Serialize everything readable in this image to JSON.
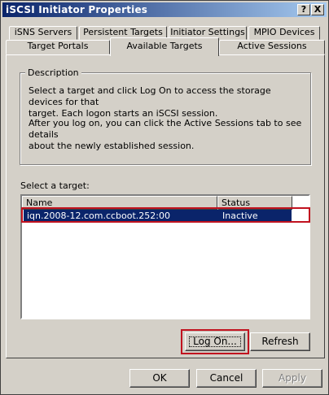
{
  "window": {
    "title": "iSCSI Initiator Properties"
  },
  "titlebar_buttons": {
    "help": "?",
    "close": "X"
  },
  "tabs_top": [
    "iSNS Servers",
    "Persistent Targets",
    "Initiator Settings",
    "MPIO Devices"
  ],
  "tabs_bottom": [
    "Target Portals",
    "Available Targets",
    "Active Sessions"
  ],
  "active_tab": "Available Targets",
  "description": {
    "label": "Description",
    "para1_line1": "Select a target and click Log On to access the storage devices for that",
    "para1_line2": "target. Each logon starts an iSCSI session.",
    "para2_line1": "After you log on, you can click the Active Sessions tab to see details",
    "para2_line2": "about the newly established session."
  },
  "targets": {
    "label": "Select a target:",
    "columns": [
      "Name",
      "Status"
    ],
    "rows": [
      {
        "name": "iqn.2008-12.com.ccboot.252:00",
        "status": "Inactive"
      }
    ]
  },
  "buttons": {
    "log_on": "Log On...",
    "refresh": "Refresh",
    "ok": "OK",
    "cancel": "Cancel",
    "apply": "Apply"
  },
  "colors": {
    "selection": "#0a246a",
    "highlight_box": "#c1121f",
    "face": "#d4d0c8"
  }
}
